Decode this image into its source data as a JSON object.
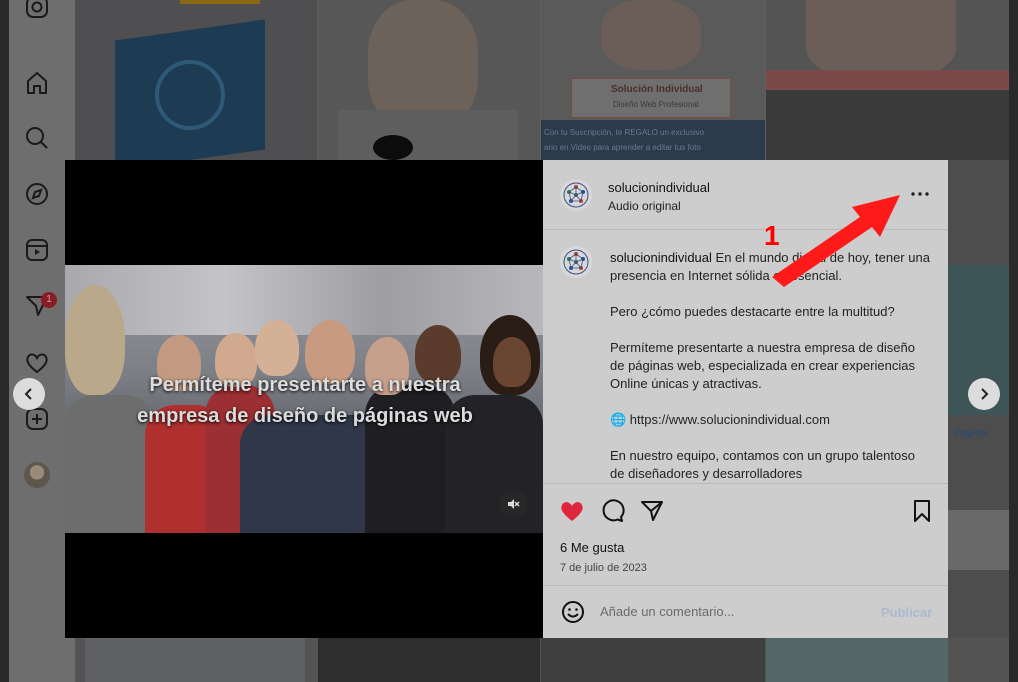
{
  "sidebar": {
    "icons": [
      "instagram-icon",
      "home-icon",
      "search-icon",
      "explore-icon",
      "reels-icon",
      "messages-icon",
      "heart-icon",
      "create-icon"
    ],
    "notification_count": "1"
  },
  "background": {
    "tile_1_label": "Solución Individual",
    "tile_1_sub": "Diseño Web Profesional",
    "tile_1_text": "Con tu Suscripción, te REGALO un exclusivo",
    "tile_1_text2": "ario en Video para aprender a editar tus foto",
    "tile_2_text": "Pagina",
    "tile_3_text": "radio"
  },
  "media": {
    "overlay_line1": "Permíteme presentarte a nuestra",
    "overlay_line2": "empresa de diseño de páginas web"
  },
  "post": {
    "username": "solucionindividual",
    "audio": "Audio original",
    "caption_user": "solucionindividual",
    "caption_p1": "En el mundo digital de hoy, tener una presencia en Internet sólida es esencial.",
    "caption_p2": "Pero ¿cómo puedes destacarte entre la multitud?",
    "caption_p3": "Permíteme presentarte a nuestra empresa de diseño de páginas web, especializada en crear experiencias Online únicas y atractivas.",
    "caption_p4": "🌐 https://www.solucionindividual.com",
    "caption_p5": "En nuestro equipo, contamos con un grupo talentoso de diseñadores y desarrolladores",
    "likes": "6 Me gusta",
    "date": "7 de julio de 2023",
    "comment_placeholder": "Añade un comentario...",
    "publish_label": "Publicar"
  },
  "annotation": {
    "number": "1",
    "color": "#ff0000"
  },
  "colors": {
    "like_heart": "#e0263d",
    "publish": "#a9b9cf"
  }
}
